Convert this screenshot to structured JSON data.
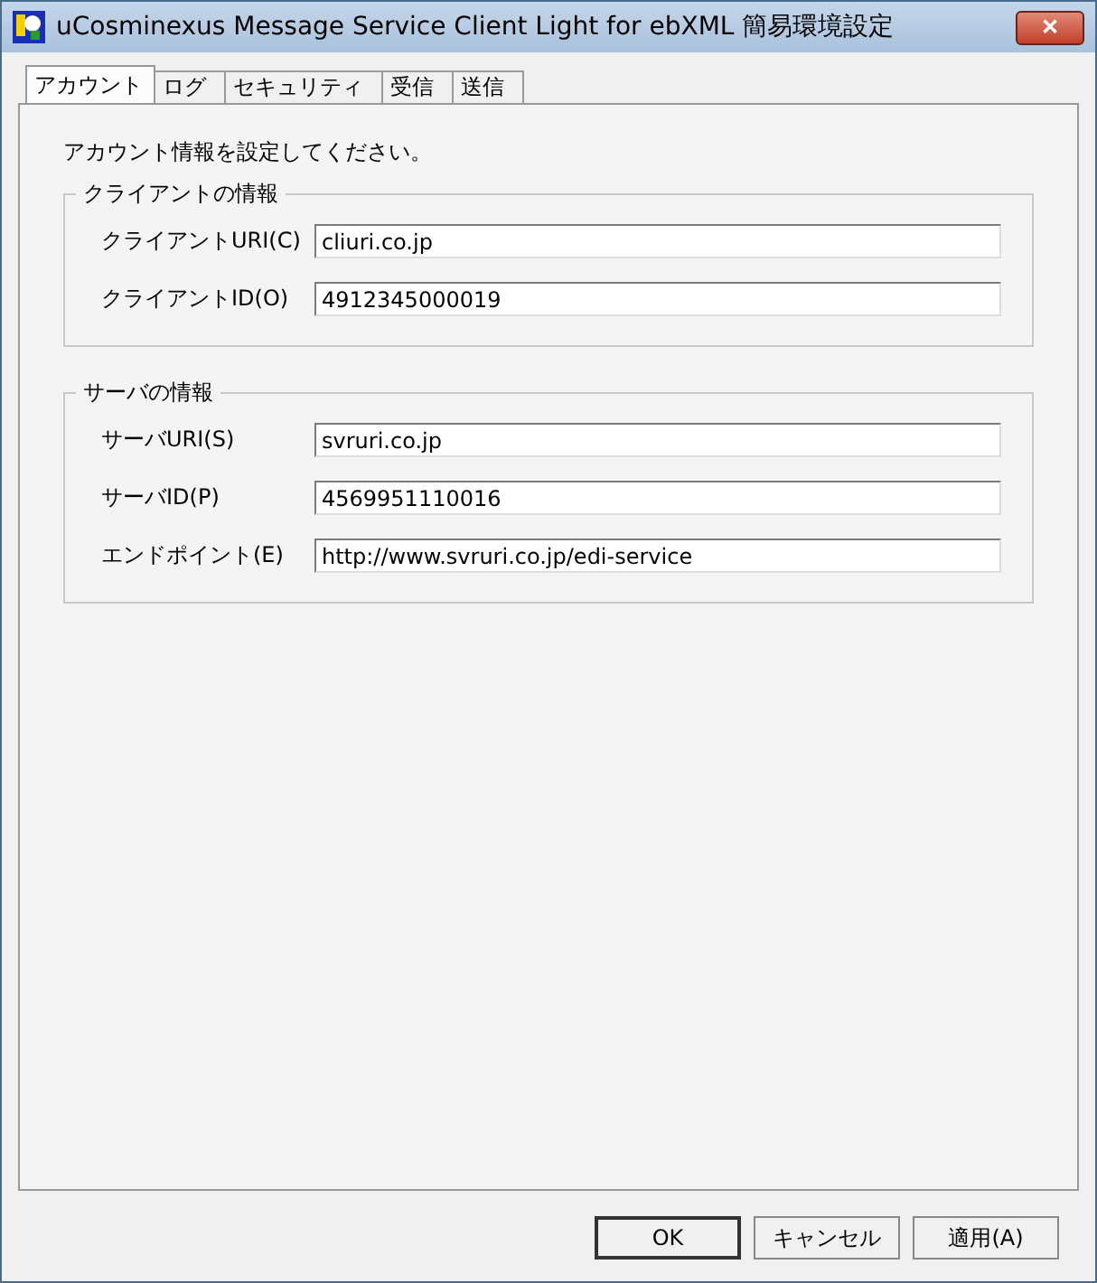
{
  "window": {
    "title": "uCosminexus Message Service Client Light for ebXML 簡易環境設定",
    "close": "✕"
  },
  "tabs": [
    {
      "label": "アカウント",
      "selected": true
    },
    {
      "label": "ログ",
      "selected": false
    },
    {
      "label": "セキュリティ",
      "selected": false
    },
    {
      "label": "受信",
      "selected": false
    },
    {
      "label": "送信",
      "selected": false
    }
  ],
  "intro": "アカウント情報を設定してください。",
  "groups": [
    {
      "title": "クライアントの情報",
      "fields": [
        {
          "label": "クライアントURI(C)",
          "value": "cliuri.co.jp"
        },
        {
          "label": "クライアントID(O)",
          "value": "4912345000019"
        }
      ]
    },
    {
      "title": "サーバの情報",
      "fields": [
        {
          "label": "サーバURI(S)",
          "value": "svruri.co.jp"
        },
        {
          "label": "サーバID(P)",
          "value": "4569951110016"
        },
        {
          "label": "エンドポイント(E)",
          "value": "http://www.svruri.co.jp/edi-service"
        }
      ]
    }
  ],
  "buttons": [
    {
      "label": "OK",
      "default": true
    },
    {
      "label": "キャンセル",
      "default": false
    },
    {
      "label": "適用(A)",
      "default": false
    }
  ]
}
